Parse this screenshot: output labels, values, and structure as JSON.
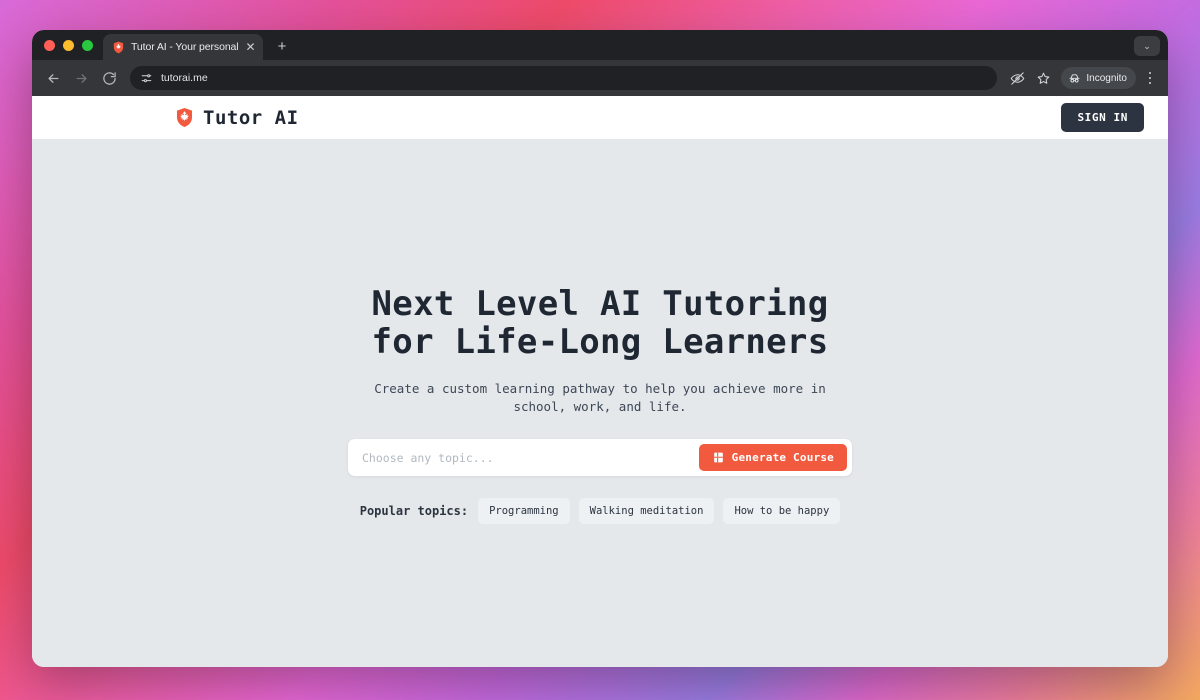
{
  "browser": {
    "tab": {
      "title": "Tutor AI - Your personal AI tu",
      "close_label": "✕",
      "favicon_name": "shield-favicon"
    },
    "new_tab_label": "+",
    "window_chevron_label": "⌄",
    "nav": {
      "back_label": "←",
      "forward_label": "→",
      "reload_label": "⟳"
    },
    "omnibox": {
      "url": "tutorai.me",
      "site_settings_icon": "sliders-icon"
    },
    "right_controls": {
      "blocked_cookies_icon": "eye-slash-icon",
      "bookmark_icon": "star-icon",
      "incognito_label": "Incognito",
      "incognito_icon": "incognito-hat-icon",
      "menu_icon": "kebab-menu-icon"
    }
  },
  "site": {
    "header": {
      "brand_name": "Tutor AI",
      "brand_mark": "orange-shield-logo",
      "sign_in_label": "SIGN IN"
    },
    "hero": {
      "title": "Next Level AI Tutoring\nfor Life-Long Learners",
      "subtitle": "Create a custom learning pathway to help you achieve more in\nschool, work, and life."
    },
    "search": {
      "placeholder": "Choose any topic...",
      "value": "",
      "generate_label": "Generate Course",
      "generate_icon": "book-icon"
    },
    "popular": {
      "label": "Popular topics:",
      "topics": [
        "Programming",
        "Walking meditation",
        "How to be happy"
      ]
    }
  },
  "colors": {
    "accent_orange": "#f15a3f",
    "ink": "#2b3440",
    "page_bg": "#e5e8eb",
    "chrome_dark": "#202124"
  }
}
